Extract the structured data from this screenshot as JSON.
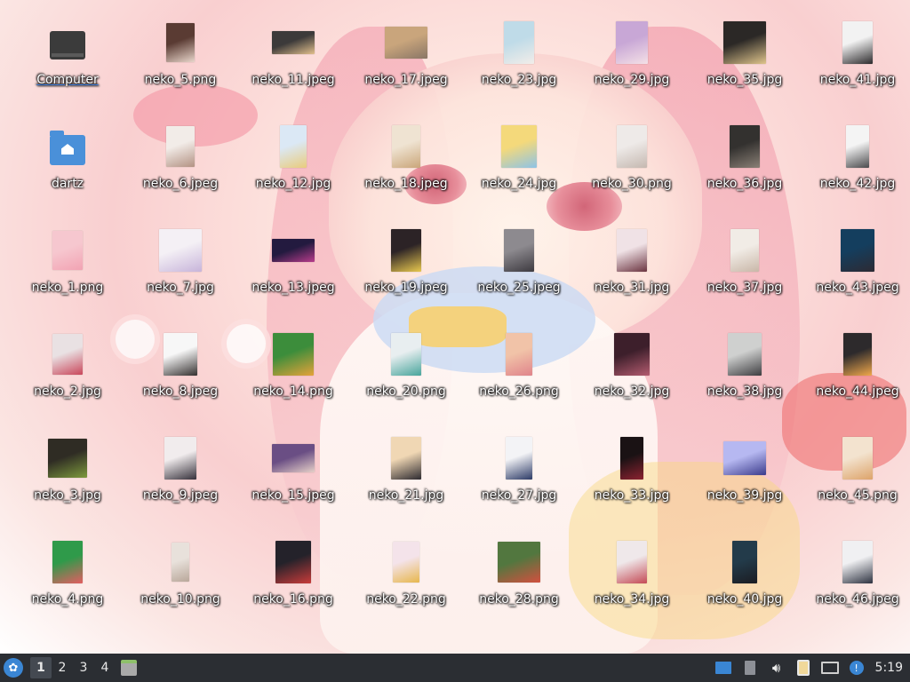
{
  "desktop": {
    "icons": [
      {
        "label": "Computer",
        "kind": "computer",
        "selected": true
      },
      {
        "label": "dartz",
        "kind": "folder"
      },
      {
        "label": "neko_1.png",
        "colors": [
          "#f6c7cf",
          "#f2a3b3"
        ],
        "w": 34,
        "h": 44
      },
      {
        "label": "neko_2.jpg",
        "colors": [
          "#e9e1e3",
          "#c9465a"
        ],
        "w": 34,
        "h": 46
      },
      {
        "label": "neko_3.jpg",
        "colors": [
          "#2f2c24",
          "#7e9a3c"
        ],
        "w": 44,
        "h": 44
      },
      {
        "label": "neko_4.png",
        "colors": [
          "#2f9a4a",
          "#e45d61"
        ],
        "w": 34,
        "h": 48
      },
      {
        "label": "neko_5.png",
        "colors": [
          "#5a3b33",
          "#e9d6cb"
        ],
        "w": 32,
        "h": 44
      },
      {
        "label": "neko_6.jpeg",
        "colors": [
          "#f2ece8",
          "#b39283"
        ],
        "w": 32,
        "h": 46
      },
      {
        "label": "neko_7.jpg",
        "colors": [
          "#f4f0f5",
          "#c7b4da"
        ],
        "w": 48,
        "h": 48
      },
      {
        "label": "neko_8.jpeg",
        "colors": [
          "#f7f7f7",
          "#34302f"
        ],
        "w": 38,
        "h": 48
      },
      {
        "label": "neko_9.jpeg",
        "colors": [
          "#f1eced",
          "#35303a"
        ],
        "w": 36,
        "h": 48
      },
      {
        "label": "neko_10.png",
        "colors": [
          "#e8e1db",
          "#b9a79a"
        ],
        "w": 20,
        "h": 44
      },
      {
        "label": "neko_11.jpeg",
        "colors": [
          "#3c3a3a",
          "#e2c08d"
        ],
        "w": 48,
        "h": 26
      },
      {
        "label": "neko_12.jpg",
        "colors": [
          "#dbe8f5",
          "#e9cc7d"
        ],
        "w": 30,
        "h": 48
      },
      {
        "label": "neko_13.jpeg",
        "colors": [
          "#231a3f",
          "#b83c8c"
        ],
        "w": 48,
        "h": 26
      },
      {
        "label": "neko_14.png",
        "colors": [
          "#3c8d3b",
          "#e5a23a"
        ],
        "w": 46,
        "h": 48
      },
      {
        "label": "neko_15.jpeg",
        "colors": [
          "#6a4e84",
          "#e6d0c8"
        ],
        "w": 48,
        "h": 32
      },
      {
        "label": "neko_16.png",
        "colors": [
          "#24222a",
          "#c93b3a"
        ],
        "w": 40,
        "h": 48
      },
      {
        "label": "neko_17.jpeg",
        "colors": [
          "#c9a57c",
          "#8a7666"
        ],
        "w": 48,
        "h": 36
      },
      {
        "label": "neko_18.jpeg",
        "colors": [
          "#efe3d2",
          "#caa67a"
        ],
        "w": 32,
        "h": 48
      },
      {
        "label": "neko_19.jpeg",
        "colors": [
          "#2c2326",
          "#e8c84e"
        ],
        "w": 34,
        "h": 48
      },
      {
        "label": "neko_20.png",
        "colors": [
          "#e8eef0",
          "#48a59c"
        ],
        "w": 34,
        "h": 48
      },
      {
        "label": "neko_21.jpg",
        "colors": [
          "#f0d7b4",
          "#2d2a30"
        ],
        "w": 34,
        "h": 48
      },
      {
        "label": "neko_22.png",
        "colors": [
          "#f4e3ea",
          "#e7b74d"
        ],
        "w": 30,
        "h": 46
      },
      {
        "label": "neko_23.jpg",
        "colors": [
          "#bfdbe8",
          "#f2ede9"
        ],
        "w": 34,
        "h": 48
      },
      {
        "label": "neko_24.jpg",
        "colors": [
          "#f4d97b",
          "#8ec3e6"
        ],
        "w": 40,
        "h": 48
      },
      {
        "label": "neko_25.jpeg",
        "colors": [
          "#8d8a8f",
          "#3d3a40"
        ],
        "w": 34,
        "h": 48
      },
      {
        "label": "neko_26.png",
        "colors": [
          "#f1c3a8",
          "#e0848b"
        ],
        "w": 30,
        "h": 48
      },
      {
        "label": "neko_27.jpg",
        "colors": [
          "#f3f3f6",
          "#2c3a66"
        ],
        "w": 30,
        "h": 48
      },
      {
        "label": "neko_28.png",
        "colors": [
          "#52773f",
          "#d3503f"
        ],
        "w": 48,
        "h": 46
      },
      {
        "label": "neko_29.jpg",
        "colors": [
          "#c8a7d6",
          "#f4e0e6"
        ],
        "w": 36,
        "h": 48
      },
      {
        "label": "neko_30.png",
        "colors": [
          "#eeeae8",
          "#c5b8b0"
        ],
        "w": 34,
        "h": 48
      },
      {
        "label": "neko_31.jpg",
        "colors": [
          "#f0e2e6",
          "#6b3440"
        ],
        "w": 34,
        "h": 48
      },
      {
        "label": "neko_32.jpg",
        "colors": [
          "#3d1f2b",
          "#b35b6f"
        ],
        "w": 40,
        "h": 48
      },
      {
        "label": "neko_33.jpg",
        "colors": [
          "#1a1214",
          "#8c2230"
        ],
        "w": 26,
        "h": 48
      },
      {
        "label": "neko_34.jpg",
        "colors": [
          "#efe8ea",
          "#c44a55"
        ],
        "w": 34,
        "h": 48
      },
      {
        "label": "neko_35.jpg",
        "colors": [
          "#2b2826",
          "#e0c58c"
        ],
        "w": 48,
        "h": 48
      },
      {
        "label": "neko_36.jpg",
        "colors": [
          "#33312f",
          "#8a8076"
        ],
        "w": 34,
        "h": 48
      },
      {
        "label": "neko_37.jpg",
        "colors": [
          "#f1ece6",
          "#c9b7a8"
        ],
        "w": 32,
        "h": 48
      },
      {
        "label": "neko_38.jpg",
        "colors": [
          "#cfd0cf",
          "#3d3d40"
        ],
        "w": 38,
        "h": 48
      },
      {
        "label": "neko_39.jpg",
        "colors": [
          "#b6b8f1",
          "#3b3b8c"
        ],
        "w": 48,
        "h": 38
      },
      {
        "label": "neko_40.jpg",
        "colors": [
          "#233b4a",
          "#1b1c22"
        ],
        "w": 28,
        "h": 48
      },
      {
        "label": "neko_41.jpg",
        "colors": [
          "#f2f2f2",
          "#2c2a2c"
        ],
        "w": 34,
        "h": 48
      },
      {
        "label": "neko_42.jpg",
        "colors": [
          "#f4f4f4",
          "#4a4a4c"
        ],
        "w": 26,
        "h": 48
      },
      {
        "label": "neko_43.jpeg",
        "colors": [
          "#143e5e",
          "#2d2a33"
        ],
        "w": 38,
        "h": 48
      },
      {
        "label": "neko_44.jpeg",
        "colors": [
          "#2d2a2c",
          "#f0a84b"
        ],
        "w": 32,
        "h": 48
      },
      {
        "label": "neko_45.png",
        "colors": [
          "#f3e3cf",
          "#dda36a"
        ],
        "w": 34,
        "h": 48
      },
      {
        "label": "neko_46.jpeg",
        "colors": [
          "#f0f0f2",
          "#2d3240"
        ],
        "w": 34,
        "h": 48
      }
    ]
  },
  "taskbar": {
    "menu_icon": "xfce-menu-icon",
    "workspaces": [
      "1",
      "2",
      "3",
      "4"
    ],
    "active_workspace": "1",
    "tray_icons": [
      "blue-window-icon",
      "network-up-icon",
      "volume-icon",
      "clipboard-icon",
      "display-icon",
      "notification-icon"
    ],
    "clock": "5:19",
    "accent": "#3a86d4",
    "bg": "#2b2e33"
  }
}
